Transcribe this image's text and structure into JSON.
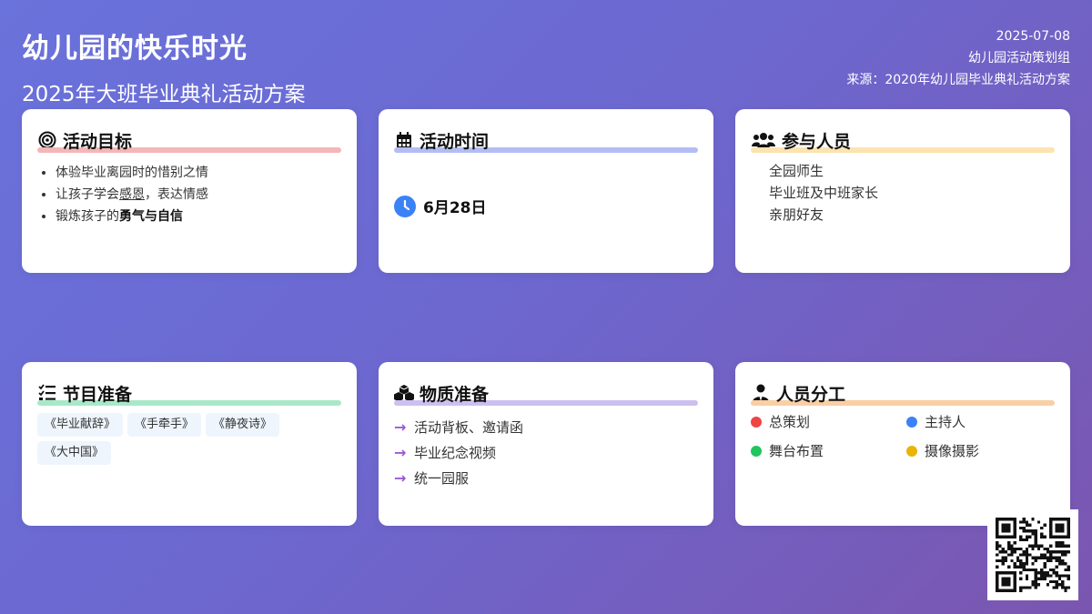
{
  "header": {
    "title": "幼儿园的快乐时光",
    "subtitle": "2025年大班毕业典礼活动方案",
    "date": "2025-07-08",
    "organizer": "幼儿园活动策划组",
    "source": "来源：2020年幼儿园毕业典礼活动方案"
  },
  "goals": {
    "title": "活动目标",
    "icon": "target-icon",
    "accent": "#f4b6b6",
    "item1": "体验毕业离园时的惜别之情",
    "item2_pre": "让孩子学会",
    "item2_em": "感恩",
    "item2_post": "，表达情感",
    "item3_pre": "锻炼孩子的",
    "item3_em": "勇气与自信"
  },
  "time": {
    "title": "活动时间",
    "icon": "calendar-icon",
    "accent": "#b4bdf3",
    "value": "6月28日"
  },
  "participants": {
    "title": "参与人员",
    "icon": "users-icon",
    "accent": "#fde3b0",
    "items": [
      "全园师生",
      "毕业班及中班家长",
      "亲朋好友"
    ]
  },
  "programs": {
    "title": "节目准备",
    "icon": "checklist-icon",
    "accent": "#a8e8c8",
    "items": [
      "《毕业献辞》",
      "《手牵手》",
      "《静夜诗》",
      "《大中国》"
    ]
  },
  "supplies": {
    "title": "物质准备",
    "icon": "boxes-icon",
    "accent": "#cdbff0",
    "items": [
      "活动背板、邀请函",
      "毕业纪念视频",
      "统一园服"
    ]
  },
  "roles": {
    "title": "人员分工",
    "icon": "person-icon",
    "accent": "#f9cfa4",
    "items": [
      {
        "label": "总策划",
        "color": "#ef4444"
      },
      {
        "label": "主持人",
        "color": "#3b82f6"
      },
      {
        "label": "舞台布置",
        "color": "#22c55e"
      },
      {
        "label": "摄像摄影",
        "color": "#eab308"
      }
    ]
  }
}
